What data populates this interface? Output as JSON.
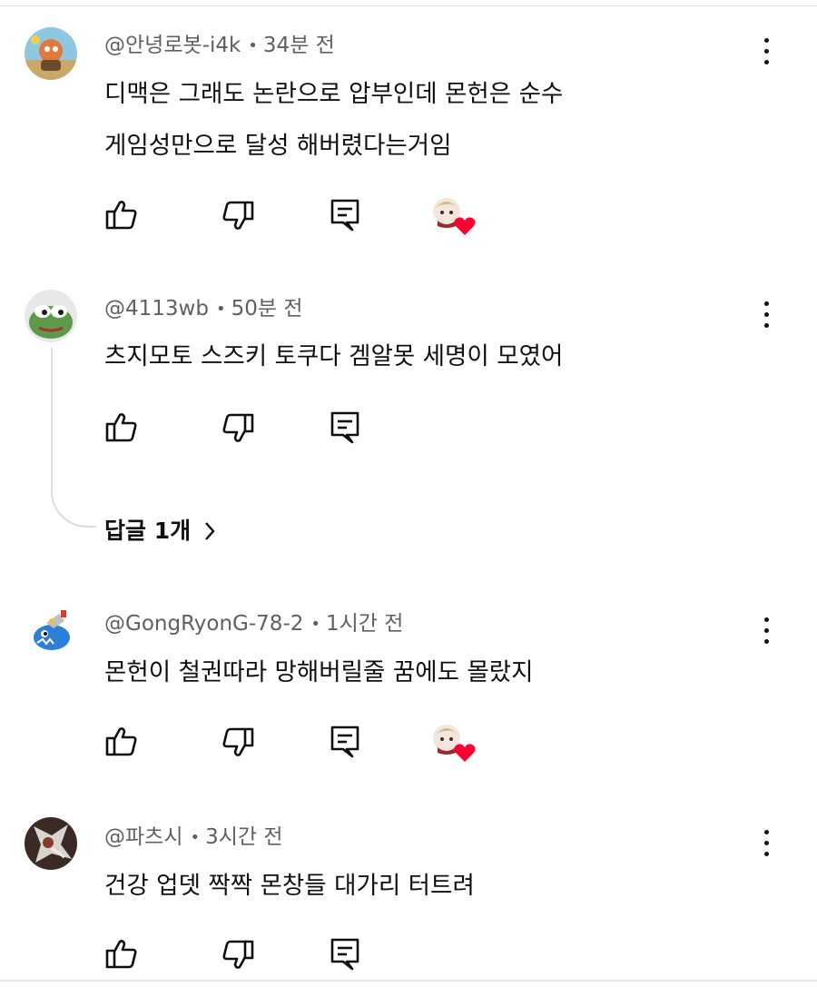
{
  "comments": [
    {
      "author": "@안녕로봇-i4k",
      "time": "34분 전",
      "lines": [
        "디맥은 그래도 논란으로 압부인데 몬헌은 순수",
        "게임성만으로 달성 해버렸다는거임"
      ],
      "creator_heart": true
    },
    {
      "author": "@4113wb",
      "time": "50분 전",
      "lines": [
        "츠지모토 스즈키 토쿠다 겜알못 세명이 모였어"
      ],
      "creator_heart": false,
      "replies_label": "답글 1개"
    },
    {
      "author": "@GongRyonG-78-2",
      "time": "1시간 전",
      "lines": [
        "몬헌이 철권따라 망해버릴줄 꿈에도 몰랐지"
      ],
      "creator_heart": true
    },
    {
      "author": "@파츠시",
      "time": "3시간 전",
      "lines": [
        "건강 업뎃 짝짝 몬창들 대가리 터트려"
      ],
      "creator_heart": false
    }
  ],
  "meta_separator": "•",
  "icons": {
    "like": "thumb-up-icon",
    "dislike": "thumb-down-icon",
    "reply": "reply-icon",
    "more": "more-vertical-icon",
    "heart": "creator-heart-icon",
    "chevron": "chevron-right-icon"
  },
  "colors": {
    "text": "#0f0f0f",
    "meta": "#606060",
    "heart": "#ff0033",
    "divider": "#e2e2e2"
  }
}
